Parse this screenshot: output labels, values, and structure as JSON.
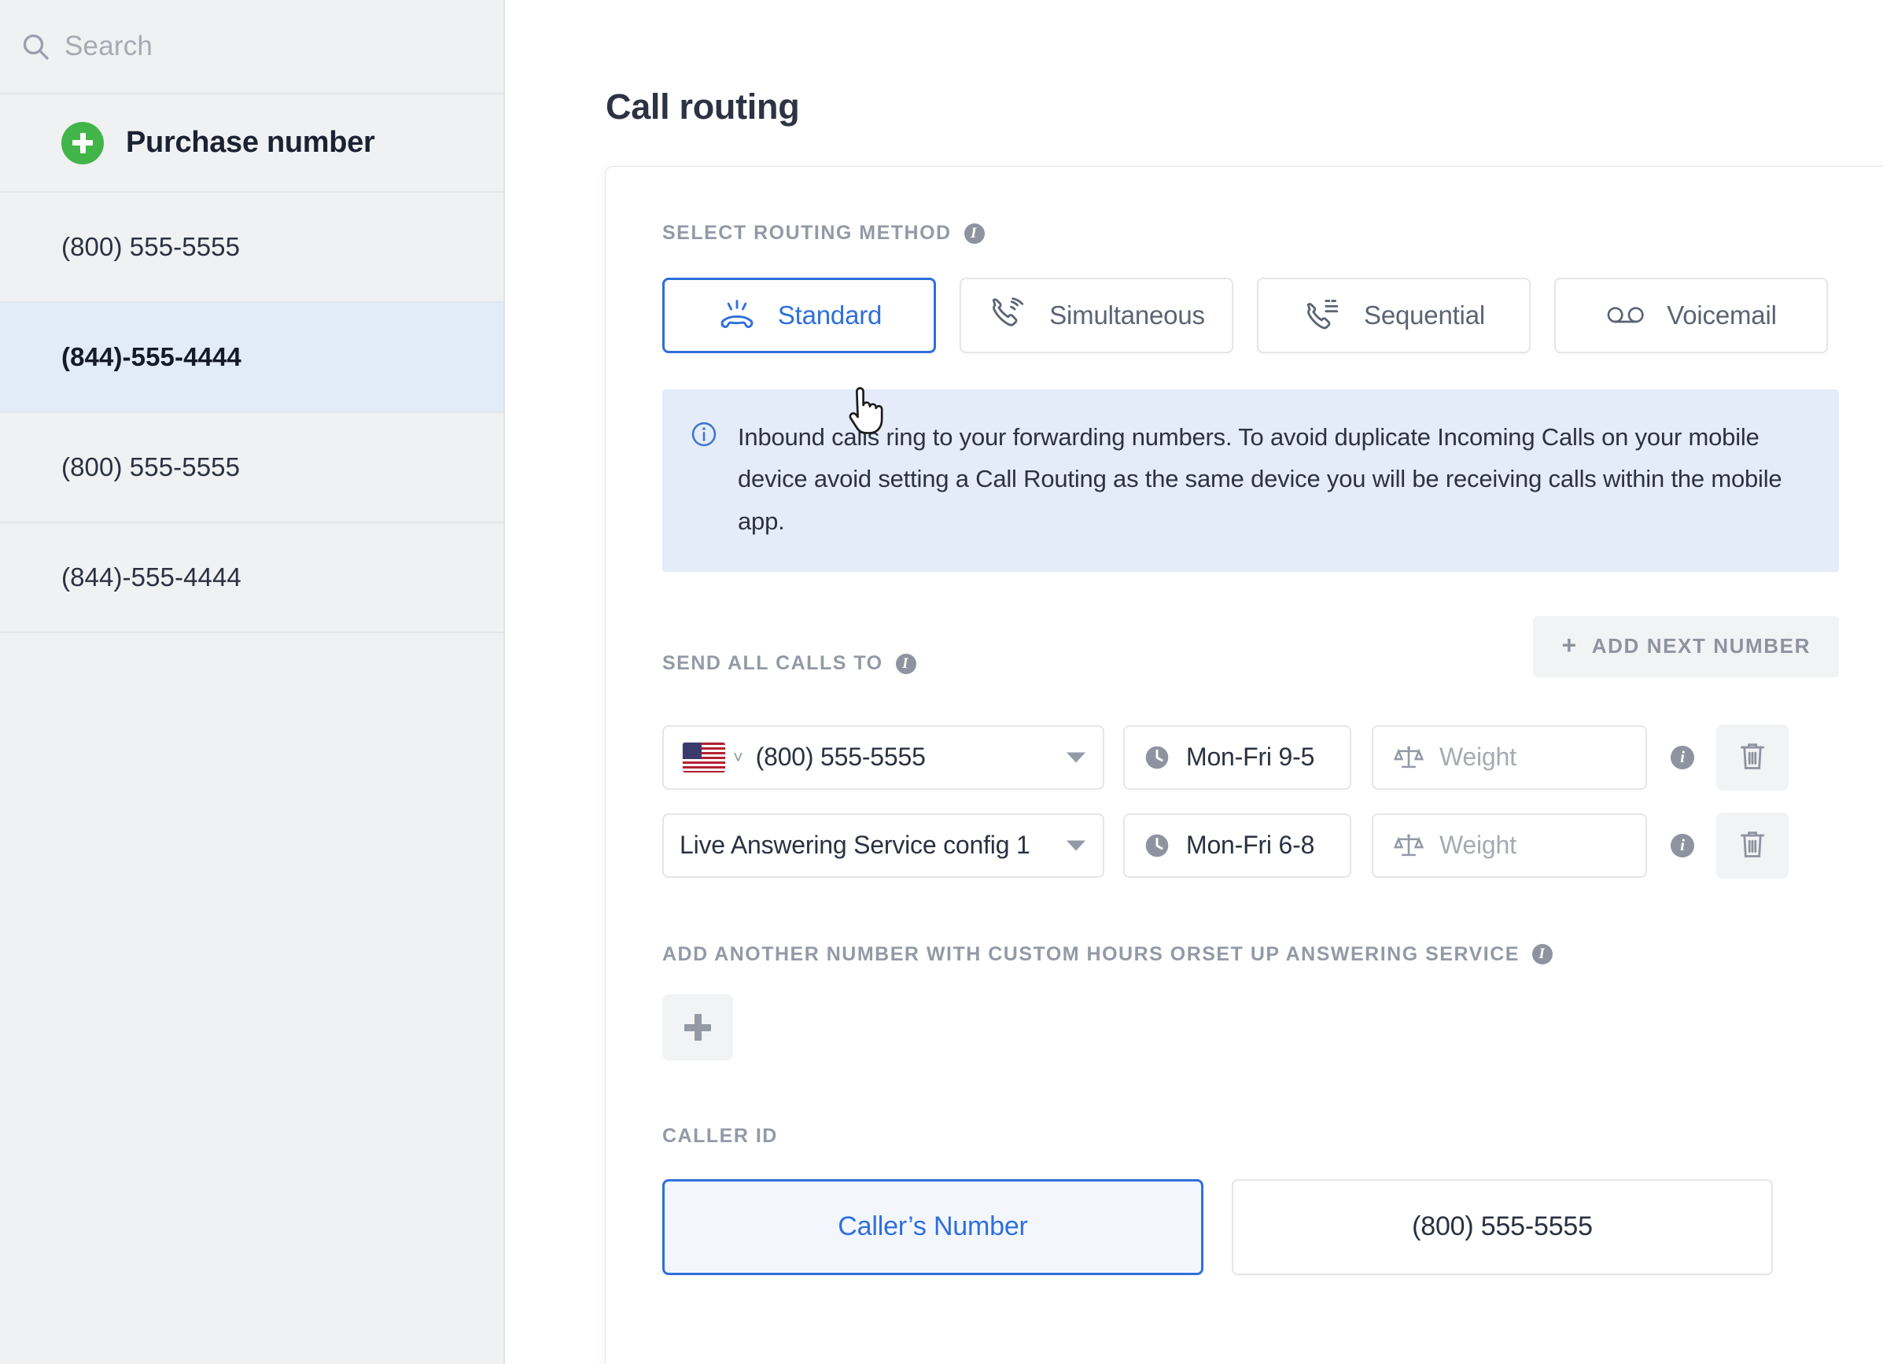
{
  "sidebar": {
    "search": {
      "placeholder": "Search",
      "value": "",
      "icon": "search-icon"
    },
    "purchase": {
      "label": "Purchase number",
      "icon": "plus-circle-icon"
    },
    "numbers": [
      {
        "label": "(800) 555-5555",
        "active": false
      },
      {
        "label": "(844)-555-4444",
        "active": true
      },
      {
        "label": "(800) 555-5555",
        "active": false
      },
      {
        "label": "(844)-555-4444",
        "active": false
      }
    ]
  },
  "main": {
    "page_title": "Call routing",
    "routing_method": {
      "label": "SELECT ROUTING METHOD",
      "info_glyph": "i",
      "options": [
        {
          "label": "Standard",
          "icon": "phone-ringing-icon",
          "selected": true
        },
        {
          "label": "Simultaneous",
          "icon": "phone-waves-icon",
          "selected": false
        },
        {
          "label": "Sequential",
          "icon": "phone-list-icon",
          "selected": false
        },
        {
          "label": "Voicemail",
          "icon": "voicemail-icon",
          "selected": false
        }
      ]
    },
    "banner": {
      "icon": "info-circle-icon",
      "text": "Inbound calls ring to your forwarding numbers. To avoid duplicate Incoming Calls on your mobile device avoid setting a Call Routing as the same device you will be receiving calls within the mobile app."
    },
    "send_all_calls": {
      "label": "SEND ALL CALLS TO",
      "info_glyph": "i",
      "add_next_button": {
        "label": "ADD NEXT NUMBER",
        "plus": "+"
      },
      "rows": [
        {
          "type": "phone",
          "flag": "us-flag-icon",
          "number": "(800) 555-5555",
          "hours": "Mon-Fri 9-5",
          "weight_placeholder": "Weight",
          "weight_value": "",
          "info_glyph": "i",
          "delete_icon": "trash-icon"
        },
        {
          "type": "service",
          "service": "Live Answering Service config 1",
          "hours": "Mon-Fri 6-8",
          "weight_placeholder": "Weight",
          "weight_value": "",
          "info_glyph": "i",
          "delete_icon": "trash-icon"
        }
      ]
    },
    "add_another": {
      "label": "ADD ANOTHER NUMBER WITH CUSTOM HOURS ORSET UP ANSWERING SERVICE",
      "info_glyph": "i",
      "button_icon": "plus-icon"
    },
    "caller_id": {
      "label": "CALLER ID",
      "options": [
        {
          "label": "Caller’s Number",
          "selected": true
        },
        {
          "label": "(800) 555-5555",
          "selected": false
        }
      ]
    }
  },
  "colors": {
    "accent_blue": "#2f6fdc",
    "banner_bg": "#e4ecf9",
    "sidebar_bg": "#f0f1f3",
    "sidebar_active_bg": "#e2ecf8",
    "muted_text": "#9499a6",
    "green": "#42b54a"
  }
}
